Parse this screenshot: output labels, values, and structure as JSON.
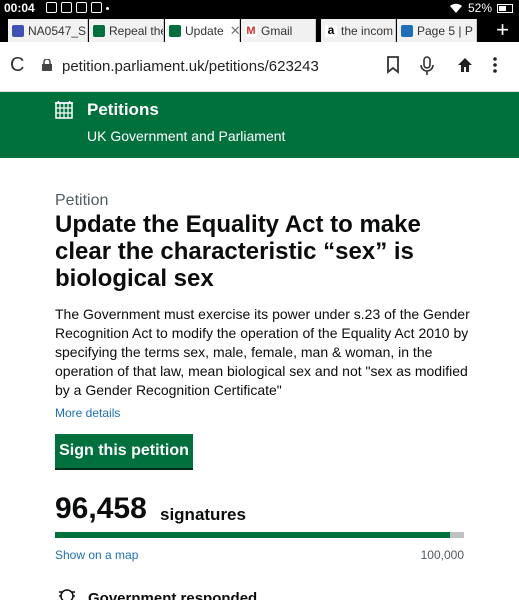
{
  "status": {
    "time": "00:04",
    "battery": "52%"
  },
  "tabs": [
    {
      "label": "NA0547_S",
      "icon_color": "#3f51b5"
    },
    {
      "label": "Repeal the",
      "icon_color": "#00703c"
    },
    {
      "label": "Update",
      "icon_color": "#00703c",
      "active": true
    },
    {
      "label": "Gmail",
      "icon_color": "#d93025"
    },
    {
      "label": "the incom",
      "icon_color": "#000000"
    },
    {
      "label": "Page 5 | P",
      "icon_color": "#1d70b8"
    }
  ],
  "browser": {
    "url": "petition.parliament.uk/petitions/623243"
  },
  "header": {
    "title": "Petitions",
    "subtitle": "UK Government and Parliament",
    "color": "#00703c"
  },
  "petition": {
    "caption": "Petition",
    "title": "Update the Equality Act to make clear the characteristic “sex” is biological sex",
    "description": "The Government must exercise its power under s.23 of the Gender Recognition Act to modify the operation of the Equality Act 2010 by specifying the terms sex, male, female, man & woman, in the operation of that law, mean biological sex and not \"sex as modified by a Gender Recognition Certificate\"",
    "more_details": "More details",
    "sign_button": "Sign this petition"
  },
  "signatures": {
    "count": "96,458",
    "label": "signatures",
    "map_link": "Show on a map",
    "target": "100,000",
    "progress": 0.9646
  },
  "response": {
    "title": "Government responded"
  }
}
